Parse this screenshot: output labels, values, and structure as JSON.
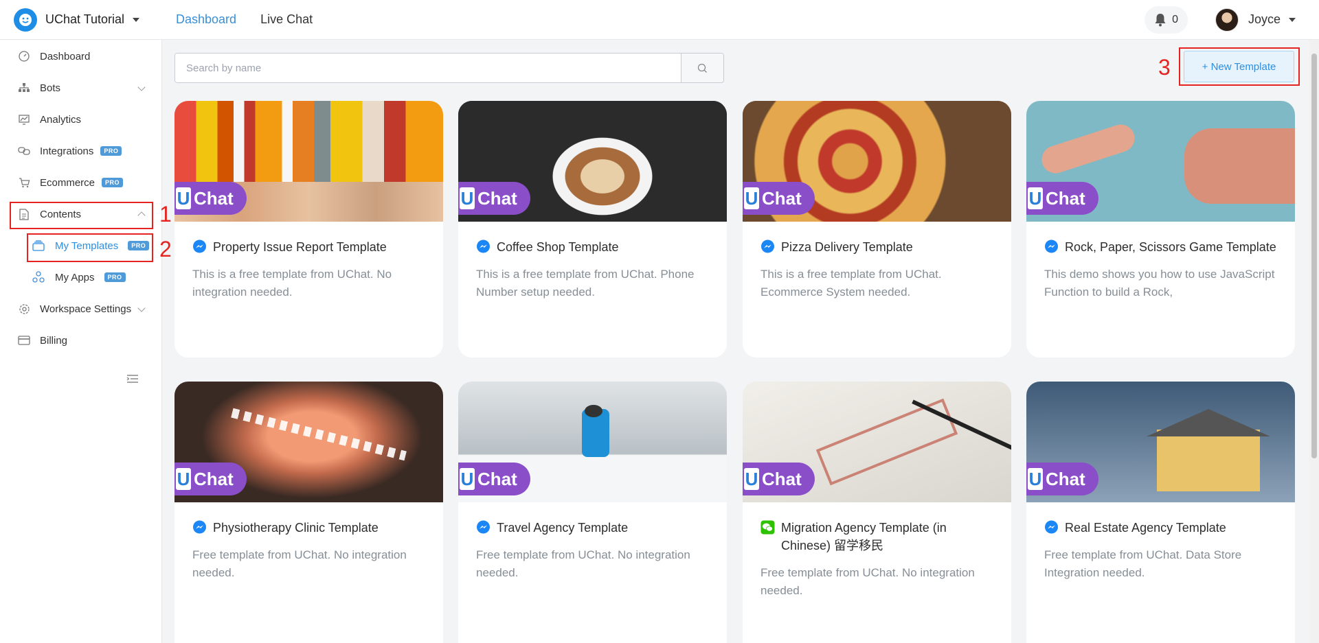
{
  "app": {
    "workspace_name": "UChat Tutorial",
    "topnav": [
      "Dashboard",
      "Live Chat"
    ],
    "notifications_count": "0",
    "user_name": "Joyce"
  },
  "sidebar": {
    "items": [
      {
        "label": "Dashboard"
      },
      {
        "label": "Bots"
      },
      {
        "label": "Analytics"
      },
      {
        "label": "Integrations",
        "badge": "PRO"
      },
      {
        "label": "Ecommerce",
        "badge": "PRO"
      },
      {
        "label": "Contents"
      },
      {
        "label": "My Templates",
        "badge": "PRO"
      },
      {
        "label": "My Apps",
        "badge": "PRO"
      },
      {
        "label": "Workspace Settings"
      },
      {
        "label": "Billing"
      }
    ]
  },
  "annotations": [
    "1",
    "2",
    "3"
  ],
  "search": {
    "placeholder": "Search by name"
  },
  "new_template_label": "+ New Template",
  "badge": {
    "u": "U",
    "chat": "Chat"
  },
  "cards": [
    {
      "title": "Property Issue Report Template",
      "desc": "This is a free template from UChat. No integration needed.",
      "channel": "messenger"
    },
    {
      "title": "Coffee Shop Template",
      "desc": "This is a free template from UChat. Phone Number setup needed.",
      "channel": "messenger"
    },
    {
      "title": "Pizza Delivery Template",
      "desc": "This is a free template from UChat. Ecommerce System needed.",
      "channel": "messenger"
    },
    {
      "title": "Rock, Paper, Scissors Game Template",
      "desc": "This demo shows you how to use JavaScript Function to build a Rock,",
      "channel": "messenger"
    },
    {
      "title": "Physiotherapy Clinic Template",
      "desc": "Free template from UChat. No integration needed.",
      "channel": "messenger"
    },
    {
      "title": "Travel Agency Template",
      "desc": "Free template from UChat. No integration needed.",
      "channel": "messenger"
    },
    {
      "title": "Migration Agency Template (in Chinese) 留学移民",
      "desc": "Free template from UChat. No integration needed.",
      "channel": "wechat"
    },
    {
      "title": "Real Estate Agency Template",
      "desc": "Free template from UChat. Data Store Integration needed.",
      "channel": "messenger"
    }
  ],
  "colors": {
    "accent": "#2d8ee0",
    "annotation": "#e52320",
    "badge_purple": "#8a4ec9"
  }
}
